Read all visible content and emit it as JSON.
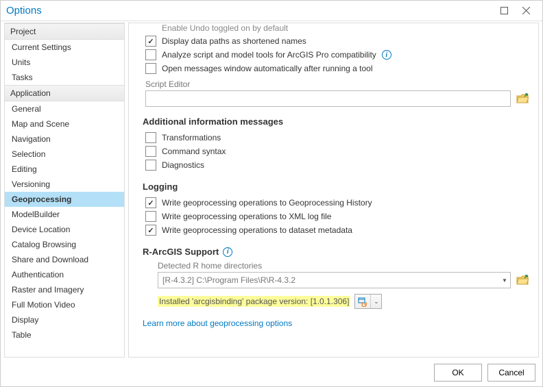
{
  "window": {
    "title": "Options"
  },
  "sidebar": {
    "groups": [
      {
        "label": "Project",
        "items": [
          "Current Settings",
          "Units",
          "Tasks"
        ]
      },
      {
        "label": "Application",
        "items": [
          "General",
          "Map and Scene",
          "Navigation",
          "Selection",
          "Editing",
          "Versioning",
          "Geoprocessing",
          "ModelBuilder",
          "Device Location",
          "Catalog Browsing",
          "Share and Download",
          "Authentication",
          "Raster and Imagery",
          "Full Motion Video",
          "Display",
          "Table"
        ]
      }
    ],
    "selected": "Geoprocessing"
  },
  "options": {
    "enable_undo": "Enable Undo toggled on by default",
    "display_paths": "Display data paths as shortened names",
    "analyze_tools": "Analyze script and model tools for ArcGIS Pro compatibility",
    "open_messages": "Open messages window automatically after running a tool",
    "script_editor_label": "Script Editor",
    "script_editor_value": ""
  },
  "additional_messages": {
    "heading": "Additional information messages",
    "transformations": "Transformations",
    "command_syntax": "Command syntax",
    "diagnostics": "Diagnostics"
  },
  "logging": {
    "heading": "Logging",
    "to_history": "Write geoprocessing operations to Geoprocessing History",
    "to_xml": "Write geoprocessing operations to XML log file",
    "to_metadata": "Write geoprocessing operations to dataset metadata"
  },
  "r_support": {
    "heading": "R-ArcGIS Support",
    "detected_label": "Detected R home directories",
    "detected_value": "[R-4.3.2] C:\\Program Files\\R\\R-4.3.2",
    "installed_msg": "Installed 'arcgisbinding' package version: [1.0.1.306]"
  },
  "learn_more": "Learn more about geoprocessing options",
  "buttons": {
    "ok": "OK",
    "cancel": "Cancel"
  }
}
